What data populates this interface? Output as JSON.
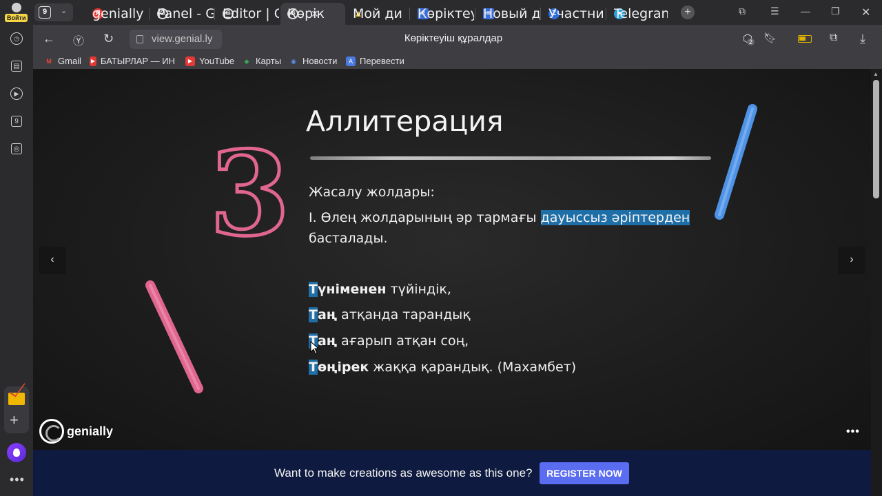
{
  "sidebar": {
    "login_label": "Войти",
    "tab_counter_icon": "9"
  },
  "tabs": {
    "count": "9",
    "items": [
      {
        "label": "genially",
        "favicon": "Я",
        "color": "#e53935"
      },
      {
        "label": "Panel - G",
        "favicon": "G",
        "color": "#333"
      },
      {
        "label": "Editor | G",
        "favicon": "G",
        "color": "#333"
      },
      {
        "label": "Көрік",
        "favicon": "G",
        "color": "#333"
      },
      {
        "label": "Мой ди",
        "favicon": "▲",
        "color": "#2b2b2e"
      },
      {
        "label": "Көріктеу",
        "favicon": "≡",
        "color": "#3b6fd8"
      },
      {
        "label": "Новый д",
        "favicon": "≡",
        "color": "#3b6fd8"
      },
      {
        "label": "Участни",
        "favicon": "Z",
        "color": "#2d6cdf"
      },
      {
        "label": "Telegran",
        "favicon": "➤",
        "color": "#2aa1de"
      }
    ]
  },
  "address": {
    "url": "view.genial.ly",
    "page_title": "Көріктеуіш құралдар",
    "badge": "2"
  },
  "bookmarks": [
    {
      "label": "Gmail",
      "icon": "M",
      "color": "#ea4335"
    },
    {
      "label": "БАТЫРЛАР — ИН",
      "icon": "▶",
      "color": "#e53935"
    },
    {
      "label": "YouTube",
      "icon": "▶",
      "color": "#e53935"
    },
    {
      "label": "Карты",
      "icon": "◆",
      "color": "#3aa757"
    },
    {
      "label": "Новости",
      "icon": "◉",
      "color": "#5b8def"
    },
    {
      "label": "Перевести",
      "icon": "A",
      "color": "#4a7be0"
    }
  ],
  "slide": {
    "title": "Аллитерация",
    "big_number": "3",
    "subtitle": "Жасалу жолдары:",
    "rule_prefix": "I. Өлең жолдарының әр тармағы ",
    "rule_highlight": "дауыссыз әріптерден",
    "rule_line2": "басталады.",
    "poem": [
      {
        "first": "Т",
        "bold_rest": "үніменен",
        "rest": " түйіндік,"
      },
      {
        "first": "Т",
        "bold_rest": "аң",
        "rest": " атқанда тарандық"
      },
      {
        "first": "Т",
        "bold_rest": "аң",
        "rest": " ағарып атқан соң,"
      },
      {
        "first": "Т",
        "bold_rest": "өңірек",
        "rest": " жаққа қарандық. (Махамбет)"
      }
    ]
  },
  "logo_text": "genially",
  "banner": {
    "text": "Want to make creations as awesome as this one?",
    "button": "REGISTER NOW"
  },
  "colors": {
    "highlight": "#1e6ea8",
    "banner_bg": "#0e1a3f",
    "register_button": "#5a6cf0",
    "chalk_pink": "#e0668f",
    "chalk_blue": "#4f93e6"
  }
}
